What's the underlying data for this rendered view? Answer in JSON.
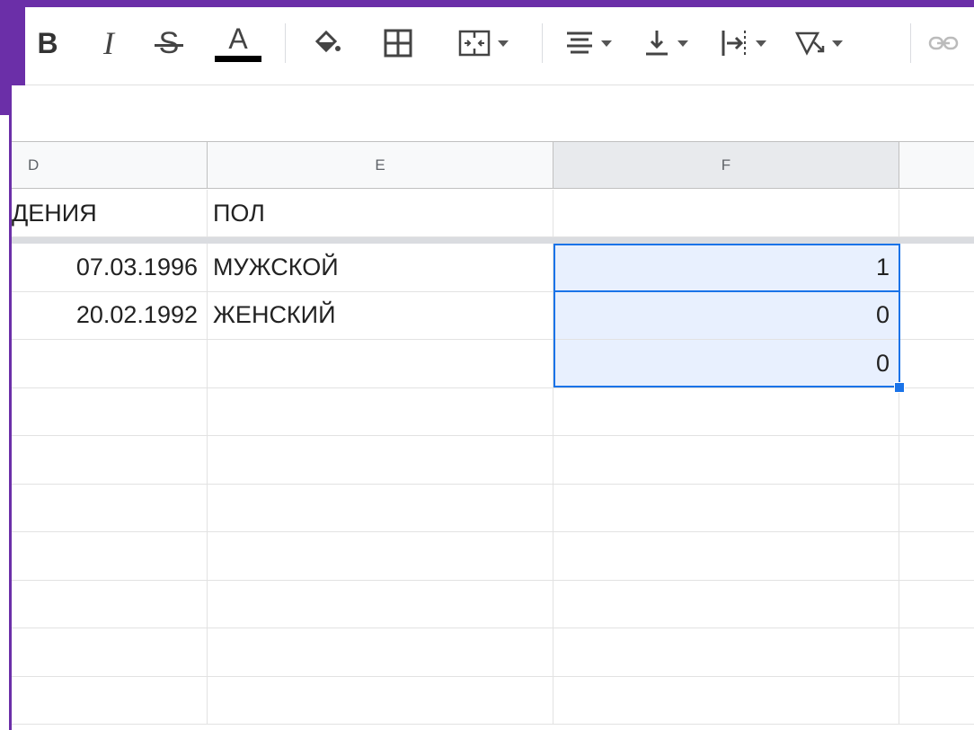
{
  "colors": {
    "slide_accent": "#6b2fa8",
    "selection": "#1a73e8",
    "selection_fill": "#e8f0fe",
    "text_color_bar": "#000000"
  },
  "toolbar": {
    "bold_label": "B",
    "italic_label": "I",
    "strikethrough_label": "S",
    "text_color_label": "A",
    "icons": [
      "bold-icon",
      "italic-icon",
      "strikethrough-icon",
      "text-color-icon",
      "fill-color-icon",
      "borders-icon",
      "merge-cells-icon",
      "horizontal-align-icon",
      "vertical-align-icon",
      "text-wrapping-icon",
      "text-rotation-icon",
      "insert-link-icon"
    ]
  },
  "columns": [
    {
      "id": "D",
      "label": "D"
    },
    {
      "id": "E",
      "label": "E"
    },
    {
      "id": "F",
      "label": "F"
    }
  ],
  "header_row": {
    "d": "ДЕНИЯ",
    "e": "ПОЛ",
    "f": ""
  },
  "rows": [
    {
      "d": "07.03.1996",
      "e": "МУЖСКОЙ",
      "f": "1"
    },
    {
      "d": "20.02.1992",
      "e": "ЖЕНСКИЙ",
      "f": "0"
    },
    {
      "d": "",
      "e": "",
      "f": "0"
    },
    {
      "d": "",
      "e": "",
      "f": ""
    },
    {
      "d": "",
      "e": "",
      "f": ""
    },
    {
      "d": "",
      "e": "",
      "f": ""
    },
    {
      "d": "",
      "e": "",
      "f": ""
    },
    {
      "d": "",
      "e": "",
      "f": ""
    },
    {
      "d": "",
      "e": "",
      "f": ""
    },
    {
      "d": "",
      "e": "",
      "f": ""
    }
  ]
}
